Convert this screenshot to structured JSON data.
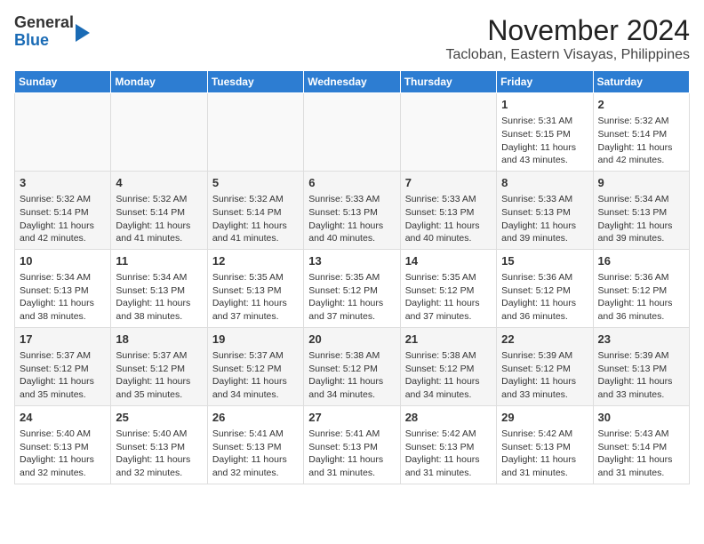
{
  "header": {
    "logo_line1": "General",
    "logo_line2": "Blue",
    "title": "November 2024",
    "subtitle": "Tacloban, Eastern Visayas, Philippines"
  },
  "calendar": {
    "days_of_week": [
      "Sunday",
      "Monday",
      "Tuesday",
      "Wednesday",
      "Thursday",
      "Friday",
      "Saturday"
    ],
    "weeks": [
      [
        {
          "day": "",
          "info": ""
        },
        {
          "day": "",
          "info": ""
        },
        {
          "day": "",
          "info": ""
        },
        {
          "day": "",
          "info": ""
        },
        {
          "day": "",
          "info": ""
        },
        {
          "day": "1",
          "info": "Sunrise: 5:31 AM\nSunset: 5:15 PM\nDaylight: 11 hours and 43 minutes."
        },
        {
          "day": "2",
          "info": "Sunrise: 5:32 AM\nSunset: 5:14 PM\nDaylight: 11 hours and 42 minutes."
        }
      ],
      [
        {
          "day": "3",
          "info": "Sunrise: 5:32 AM\nSunset: 5:14 PM\nDaylight: 11 hours and 42 minutes."
        },
        {
          "day": "4",
          "info": "Sunrise: 5:32 AM\nSunset: 5:14 PM\nDaylight: 11 hours and 41 minutes."
        },
        {
          "day": "5",
          "info": "Sunrise: 5:32 AM\nSunset: 5:14 PM\nDaylight: 11 hours and 41 minutes."
        },
        {
          "day": "6",
          "info": "Sunrise: 5:33 AM\nSunset: 5:13 PM\nDaylight: 11 hours and 40 minutes."
        },
        {
          "day": "7",
          "info": "Sunrise: 5:33 AM\nSunset: 5:13 PM\nDaylight: 11 hours and 40 minutes."
        },
        {
          "day": "8",
          "info": "Sunrise: 5:33 AM\nSunset: 5:13 PM\nDaylight: 11 hours and 39 minutes."
        },
        {
          "day": "9",
          "info": "Sunrise: 5:34 AM\nSunset: 5:13 PM\nDaylight: 11 hours and 39 minutes."
        }
      ],
      [
        {
          "day": "10",
          "info": "Sunrise: 5:34 AM\nSunset: 5:13 PM\nDaylight: 11 hours and 38 minutes."
        },
        {
          "day": "11",
          "info": "Sunrise: 5:34 AM\nSunset: 5:13 PM\nDaylight: 11 hours and 38 minutes."
        },
        {
          "day": "12",
          "info": "Sunrise: 5:35 AM\nSunset: 5:13 PM\nDaylight: 11 hours and 37 minutes."
        },
        {
          "day": "13",
          "info": "Sunrise: 5:35 AM\nSunset: 5:12 PM\nDaylight: 11 hours and 37 minutes."
        },
        {
          "day": "14",
          "info": "Sunrise: 5:35 AM\nSunset: 5:12 PM\nDaylight: 11 hours and 37 minutes."
        },
        {
          "day": "15",
          "info": "Sunrise: 5:36 AM\nSunset: 5:12 PM\nDaylight: 11 hours and 36 minutes."
        },
        {
          "day": "16",
          "info": "Sunrise: 5:36 AM\nSunset: 5:12 PM\nDaylight: 11 hours and 36 minutes."
        }
      ],
      [
        {
          "day": "17",
          "info": "Sunrise: 5:37 AM\nSunset: 5:12 PM\nDaylight: 11 hours and 35 minutes."
        },
        {
          "day": "18",
          "info": "Sunrise: 5:37 AM\nSunset: 5:12 PM\nDaylight: 11 hours and 35 minutes."
        },
        {
          "day": "19",
          "info": "Sunrise: 5:37 AM\nSunset: 5:12 PM\nDaylight: 11 hours and 34 minutes."
        },
        {
          "day": "20",
          "info": "Sunrise: 5:38 AM\nSunset: 5:12 PM\nDaylight: 11 hours and 34 minutes."
        },
        {
          "day": "21",
          "info": "Sunrise: 5:38 AM\nSunset: 5:12 PM\nDaylight: 11 hours and 34 minutes."
        },
        {
          "day": "22",
          "info": "Sunrise: 5:39 AM\nSunset: 5:12 PM\nDaylight: 11 hours and 33 minutes."
        },
        {
          "day": "23",
          "info": "Sunrise: 5:39 AM\nSunset: 5:13 PM\nDaylight: 11 hours and 33 minutes."
        }
      ],
      [
        {
          "day": "24",
          "info": "Sunrise: 5:40 AM\nSunset: 5:13 PM\nDaylight: 11 hours and 32 minutes."
        },
        {
          "day": "25",
          "info": "Sunrise: 5:40 AM\nSunset: 5:13 PM\nDaylight: 11 hours and 32 minutes."
        },
        {
          "day": "26",
          "info": "Sunrise: 5:41 AM\nSunset: 5:13 PM\nDaylight: 11 hours and 32 minutes."
        },
        {
          "day": "27",
          "info": "Sunrise: 5:41 AM\nSunset: 5:13 PM\nDaylight: 11 hours and 31 minutes."
        },
        {
          "day": "28",
          "info": "Sunrise: 5:42 AM\nSunset: 5:13 PM\nDaylight: 11 hours and 31 minutes."
        },
        {
          "day": "29",
          "info": "Sunrise: 5:42 AM\nSunset: 5:13 PM\nDaylight: 11 hours and 31 minutes."
        },
        {
          "day": "30",
          "info": "Sunrise: 5:43 AM\nSunset: 5:14 PM\nDaylight: 11 hours and 31 minutes."
        }
      ]
    ]
  }
}
